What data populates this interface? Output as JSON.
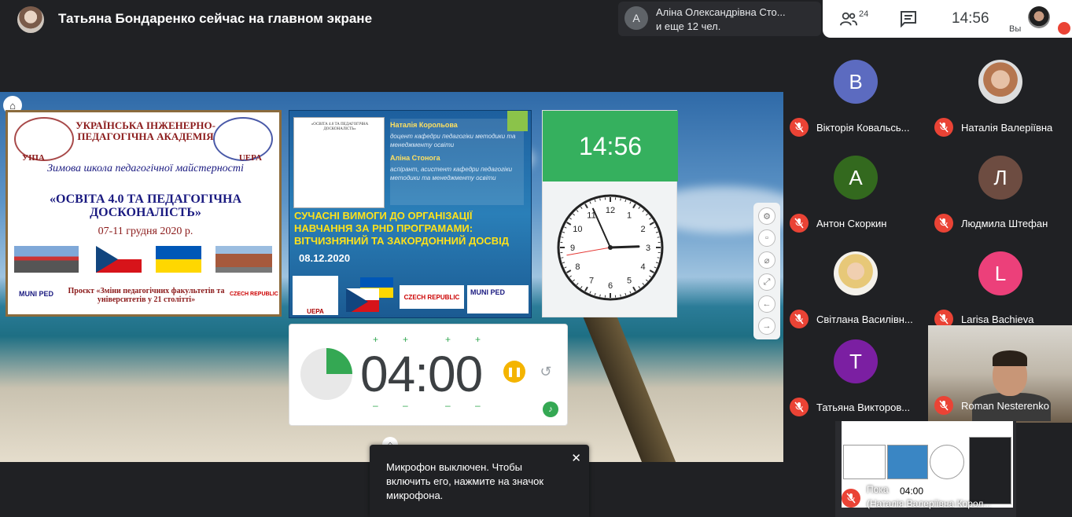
{
  "topbar": {
    "presenting_title": "Татьяна Бондаренко сейчас на главном экране",
    "speaker_name": "Аліна Олександрівна Сто...",
    "speaker_more": "и еще 12 чел.",
    "speaker_initial": "А",
    "people_count": "24",
    "clock": "14:56",
    "self_label": "Вы"
  },
  "slide1": {
    "org": "УКРАЇНСЬКА ІНЖЕНЕРНО-ПЕДАГОГІЧНА АКАДЕМІЯ",
    "uipa": "УІПА",
    "uepa": "UEPA",
    "school": "Зимова школа педагогічної майстерності",
    "conference": "«ОСВІТА 4.0 ТА ПЕДАГОГІЧНА ДОСКОНАЛІСТЬ»",
    "dates": "07-11 грудня 2020 р.",
    "muni": "MUNI PED",
    "project": "Проєкт «Зміни педагогічних факультетів та університетів у 21 столітті»",
    "czech": "CZECH REPUBLIC"
  },
  "slide2": {
    "author1": "Наталія Корольова",
    "role1": "доцент кафедри педагогіки методики та менеджменту освіти",
    "author2": "Аліна Стонога",
    "role2": "аспірант, асистент кафедри педагогіки методики та менеджменту освіти",
    "title": "Сучасні вимоги до організації навчання за PhD програмами: вітчизняний та закордонний досвід",
    "date": "08.12.2020",
    "logo_uepa": "UEPA",
    "logo_czech": "CZECH REPUBLIC",
    "logo_muni": "MUNI PED"
  },
  "clock_widget": {
    "time": "14:56",
    "numbers": [
      "12",
      "1",
      "2",
      "3",
      "4",
      "5",
      "6",
      "7",
      "8",
      "9",
      "10",
      "11"
    ]
  },
  "timer": {
    "digits": "04:00",
    "remaining_fraction": 0.25
  },
  "participants": [
    {
      "name": "Вікторія Ковальсь...",
      "initial": "В",
      "color": "#5c6bc0"
    },
    {
      "name": "Наталія Валеріївна",
      "initial": "",
      "color": "#cfb7a0"
    },
    {
      "name": "Антон Скоркин",
      "initial": "А",
      "color": "#33691e"
    },
    {
      "name": "Людмила Штефан",
      "initial": "Л",
      "color": "#6d4c41"
    },
    {
      "name": "Світлана Василівн...",
      "initial": "",
      "color": "#e9d9b6"
    },
    {
      "name": "Larisa Bachieva",
      "initial": "L",
      "color": "#ec407a"
    },
    {
      "name": "Татьяна Викторов...",
      "initial": "Т",
      "color": "#7b1fa2"
    },
    {
      "name": "Roman Nesterenko",
      "initial": "",
      "color": ""
    }
  ],
  "toast": {
    "message": "Микрофон выключен. Чтобы включить его, нажмите на значок микрофона.",
    "close": "✕"
  },
  "preview": {
    "time": "04:00",
    "line1": "Пока",
    "line2": "(Наталія Валеріївна Корол..."
  }
}
